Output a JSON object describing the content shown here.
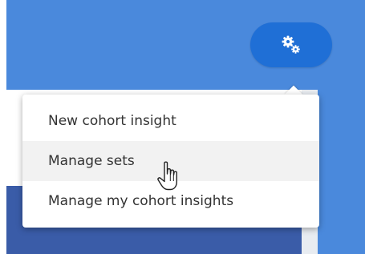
{
  "toolbar": {
    "settings_icon": "gears-icon",
    "accent_color": "#1f6fd6",
    "background_color": "#4a89dc"
  },
  "menu": {
    "items": [
      {
        "label": "New cohort insight"
      },
      {
        "label": "Manage sets"
      },
      {
        "label": "Manage my cohort insights"
      }
    ],
    "hovered_index": 1
  },
  "cursor": {
    "icon": "hand-pointer-icon"
  }
}
